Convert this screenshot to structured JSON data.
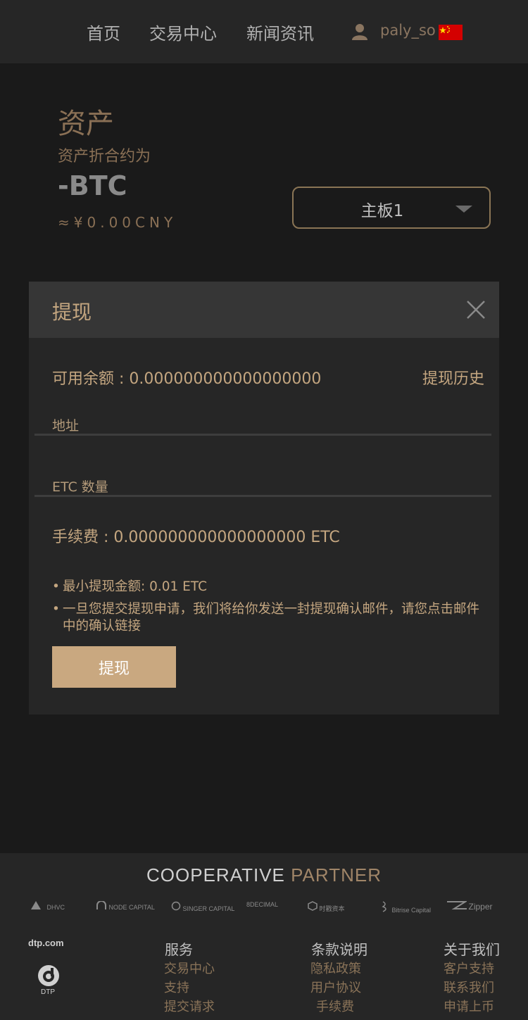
{
  "header": {
    "nav": [
      "首页",
      "交易中心",
      "新闻资讯"
    ],
    "username": "paly_so",
    "user_icon": "user-icon",
    "flag_icon": "china-flag-icon"
  },
  "assets": {
    "title": "资产",
    "subtitle": "资产折合约为",
    "btc": "-BTC",
    "cny": "≈¥0.00CNY",
    "board": {
      "selected": "主板1"
    }
  },
  "withdraw": {
    "title": "提现",
    "balance": "可用余额 : 0.000000000000000000",
    "history": "提现历史",
    "address_label": "地址",
    "address_value": "",
    "amount_label": "ETC 数量",
    "amount_value": "",
    "fee": "手续费 : 0.000000000000000000  ETC",
    "notes": [
      "最小提现金额: 0.01 ETC",
      "一旦您提交提现申请，我们将给你发送一封提现确认邮件，请您点击邮件中的确认链接"
    ],
    "bullet": "•",
    "submit": "提现"
  },
  "footer": {
    "coop_a": "COOPERATIVE",
    "coop_b": "PARTNER",
    "partners": [
      "DHVC",
      "NODE CAPITAL",
      "SINGER CAPITAL",
      "8DECIMAL",
      "时戳资本",
      "Bitrise Capital",
      "Zipper"
    ],
    "brand_text": "dtp.com",
    "brand_label": "DTP",
    "columns": [
      {
        "title": "服务",
        "links": [
          "交易中心",
          "支持",
          "提交请求"
        ]
      },
      {
        "title": "条款说明",
        "links": [
          "隐私政策",
          "用户协议",
          "手续费"
        ]
      },
      {
        "title": "关于我们",
        "links": [
          "客户支持",
          "联系我们",
          "申请上币"
        ]
      }
    ]
  },
  "colors": {
    "accent": "#c9a880",
    "background": "#1a1a1a",
    "panel": "#262626",
    "panel_header": "#363636"
  }
}
